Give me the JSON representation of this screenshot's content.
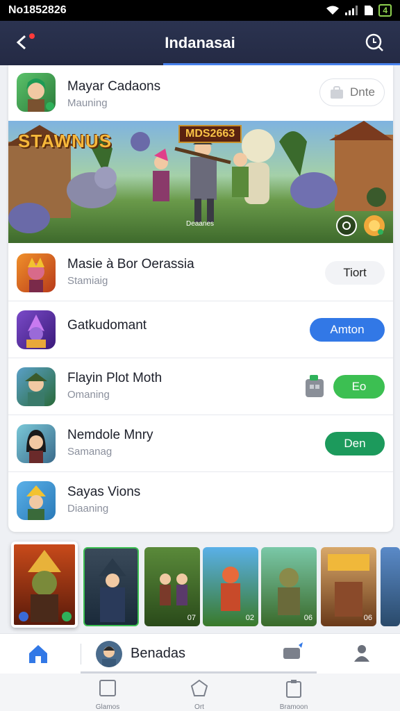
{
  "status_bar": {
    "time": "No1852826",
    "battery": "4"
  },
  "header": {
    "title": "Indanasai"
  },
  "featured_app": {
    "name": "Mayar Cadaons",
    "subtitle": "Mauning",
    "action": "Dnte"
  },
  "banner": {
    "logo_text": "STAWNUS",
    "tag_text": "MDS2663",
    "caption": "Deaanes"
  },
  "apps": [
    {
      "name": "Masie à Bor Oerassia",
      "subtitle": "Stamiaig",
      "action": "Tiort",
      "style": "grey"
    },
    {
      "name": "Gatkudomant",
      "subtitle": "",
      "action": "Amton",
      "style": "blue"
    },
    {
      "name": "Flayin Plot Moth",
      "subtitle": "Omaning",
      "action": "Eo",
      "style": "green"
    },
    {
      "name": "Nemdole Mnry",
      "subtitle": "Samanag",
      "action": "Den",
      "style": "dgreen"
    },
    {
      "name": "Sayas Vions",
      "subtitle": "Diaaning",
      "action": "",
      "style": "none"
    }
  ],
  "thumb_strip": [
    {
      "num": ""
    },
    {
      "num": ""
    },
    {
      "num": "07"
    },
    {
      "num": "02"
    },
    {
      "num": "06"
    },
    {
      "num": "06"
    },
    {
      "num": ""
    }
  ],
  "bottom_nav": {
    "label": "Benadas"
  },
  "system_nav": {
    "item1": "Glamos",
    "item2": "Ort",
    "item3": "Bramoon"
  },
  "colors": {
    "accent": "#3278e6",
    "header": "#2b3350",
    "green": "#3cbf52"
  }
}
